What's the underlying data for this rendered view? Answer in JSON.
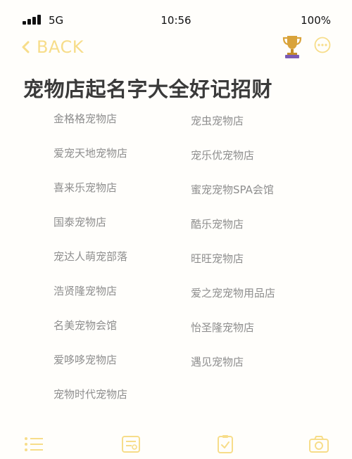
{
  "status_bar": {
    "network": "5G",
    "time": "10:56",
    "battery": "100%"
  },
  "nav": {
    "back_label": "BACK"
  },
  "page": {
    "title": "宠物店起名字大全好记招财"
  },
  "names": {
    "left": [
      "金格格宠物店",
      "爱宠天地宠物店",
      "喜来乐宠物店",
      "国泰宠物店",
      "宠达人萌宠部落",
      "浩贤隆宠物店",
      "名美宠物会馆",
      "爱哆哆宠物店",
      "宠物时代宠物店"
    ],
    "right": [
      "宠虫宠物店",
      "宠乐优宠物店",
      "蜜宠宠物SPA会馆",
      "酷乐宠物店",
      "旺旺宠物店",
      "爱之宠宠物用品店",
      "怡圣隆宠物店",
      "遇见宠物店"
    ]
  },
  "colors": {
    "accent": "#f7dd8a",
    "title": "#3a3a3a",
    "name_text": "#8e8e8e",
    "trophy": "#d9a33a"
  },
  "icons": {
    "signal": "signal-bars-icon",
    "back": "chevron-left-icon",
    "trophy": "trophy-icon",
    "more": "more-circle-icon",
    "tabs": [
      "list-icon",
      "note-icon",
      "clipboard-icon",
      "camera-icon"
    ]
  }
}
